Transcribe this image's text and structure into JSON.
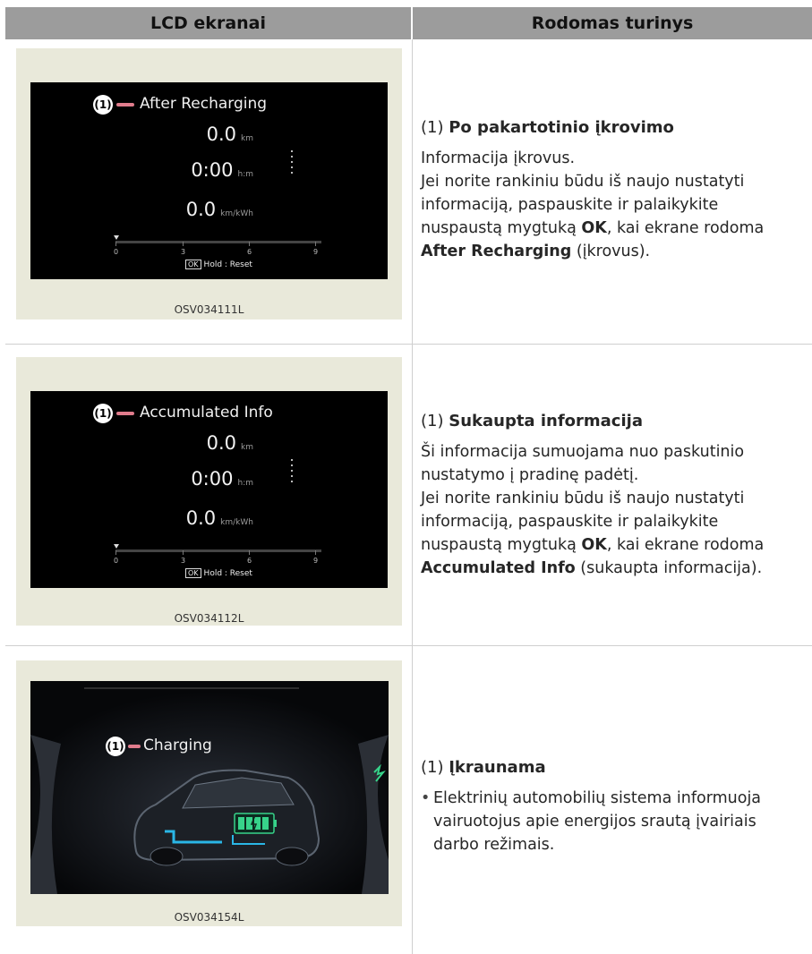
{
  "header": {
    "col1": "LCD ekranai",
    "col2": "Rodomas turinys"
  },
  "rows": [
    {
      "caption": "OSV034111L",
      "screen": {
        "badge": "(1)",
        "title": "After Recharging",
        "values": [
          {
            "value": "0.0",
            "unit": "km"
          },
          {
            "value": "0:00",
            "unit": "h:m"
          },
          {
            "value": "0.0",
            "unit": "km/kWh"
          }
        ],
        "scale_ticks": [
          "0",
          "3",
          "6",
          "9"
        ],
        "ok_label": "OK",
        "hold_text": "Hold : Reset"
      },
      "text": {
        "num": "(1)",
        "title": "Po pakartotinio įkrovimo",
        "lines": [
          "Informacija įkrovus.",
          "Jei norite rankiniu būdu iš naujo nustatyti informaciją, paspauskite ir palaikykite nuspaustą mygtuką "
        ],
        "ok": "OK",
        "after_ok": ", kai ekrane rodoma ",
        "bold_end": "After Recharging",
        "end": " (įkrovus)."
      }
    },
    {
      "caption": "OSV034112L",
      "screen": {
        "badge": "(1)",
        "title": "Accumulated Info",
        "values": [
          {
            "value": "0.0",
            "unit": "km"
          },
          {
            "value": "0:00",
            "unit": "h:m"
          },
          {
            "value": "0.0",
            "unit": "km/kWh"
          }
        ],
        "scale_ticks": [
          "0",
          "3",
          "6",
          "9"
        ],
        "ok_label": "OK",
        "hold_text": "Hold : Reset"
      },
      "text": {
        "num": "(1)",
        "title": "Sukaupta informacija",
        "lines": [
          "Ši informacija sumuojama nuo paskutinio nustatymo į pradinę padėtį.",
          "Jei norite rankiniu būdu iš naujo nustatyti informaciją, paspauskite ir palaikykite nuspaustą mygtuką "
        ],
        "ok": "OK",
        "after_ok": ", kai ekrane rodoma ",
        "bold_end": "Accumulated Info",
        "end": " (sukaupta informacija)."
      }
    },
    {
      "caption": "OSV034154L",
      "screen": {
        "badge": "(1)",
        "title": "Charging"
      },
      "text": {
        "num": "(1)",
        "title": "Įkraunama",
        "bullet": "Elektrinių automobilių sistema informuoja vairuotojus apie energijos srautą įvairiais darbo režimais."
      }
    }
  ]
}
